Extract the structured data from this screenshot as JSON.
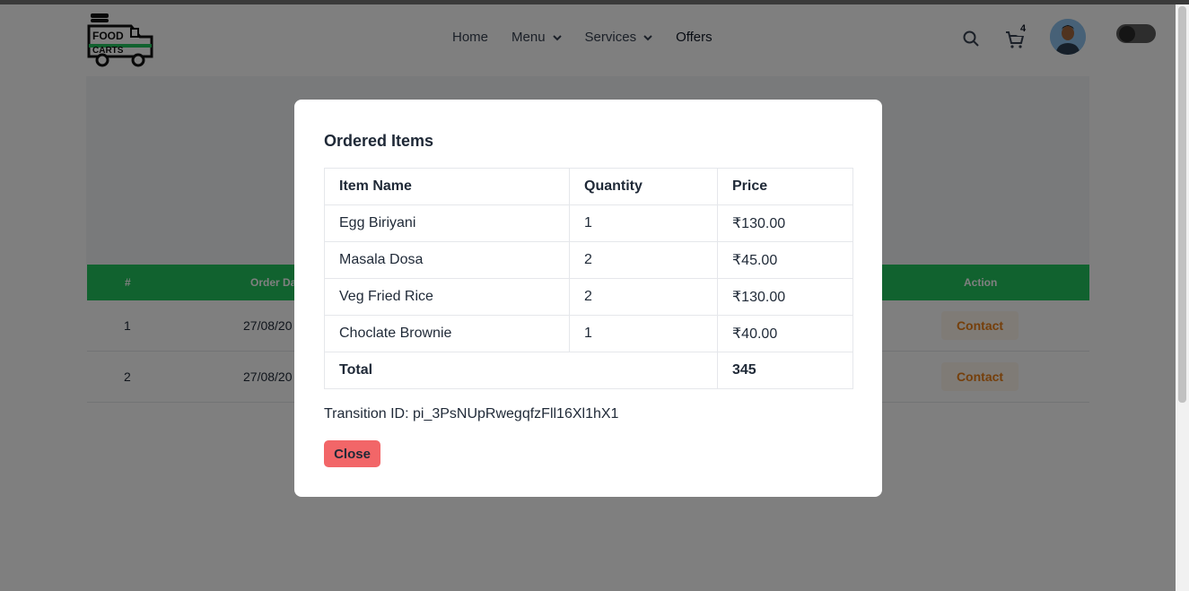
{
  "header": {
    "logo_line1": "FOOD",
    "logo_line2": "CARTS",
    "nav": [
      {
        "label": "Home",
        "dropdown": false
      },
      {
        "label": "Menu",
        "dropdown": true
      },
      {
        "label": "Services",
        "dropdown": true
      },
      {
        "label": "Offers",
        "dropdown": false
      }
    ],
    "cart_count": "4",
    "icons": [
      "search-icon",
      "cart-icon",
      "avatar",
      "theme-toggle"
    ]
  },
  "orders_table": {
    "headers": [
      "#",
      "Order Da",
      "Action"
    ],
    "rows": [
      {
        "num": "1",
        "date": "27/08/20",
        "action": "Contact"
      },
      {
        "num": "2",
        "date": "27/08/20",
        "action": "Contact"
      }
    ]
  },
  "modal": {
    "title": "Ordered Items",
    "columns": [
      "Item Name",
      "Quantity",
      "Price"
    ],
    "items": [
      {
        "name": "Egg Biriyani",
        "qty": "1",
        "price": "₹130.00"
      },
      {
        "name": "Masala Dosa",
        "qty": "2",
        "price": "₹45.00"
      },
      {
        "name": "Veg Fried Rice",
        "qty": "2",
        "price": "₹130.00"
      },
      {
        "name": "Choclate Brownie",
        "qty": "1",
        "price": "₹40.00"
      }
    ],
    "total_label": "Total",
    "total_value": "345",
    "transaction": "Transition ID: pi_3PsNUpRwegqfzFll16Xl1hX1",
    "close_label": "Close"
  },
  "colors": {
    "table_header_green": "#22c55e",
    "close_button": "#f26668",
    "contact_text": "#ea7f16",
    "overlay": "rgba(0,0,0,0.5)"
  }
}
